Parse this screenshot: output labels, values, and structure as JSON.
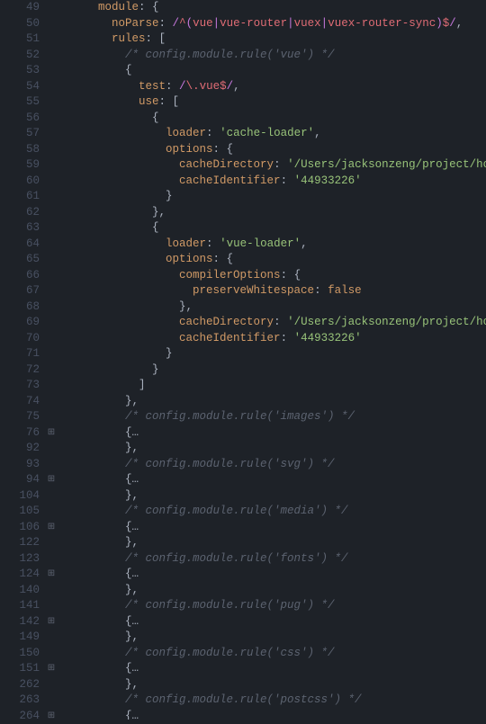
{
  "lines": [
    {
      "num": 49,
      "fold": "",
      "tokens": [
        {
          "cls": "p",
          "t": "      "
        },
        {
          "cls": "k",
          "t": "module"
        },
        {
          "cls": "p",
          "t": ": {"
        }
      ]
    },
    {
      "num": 50,
      "fold": "",
      "tokens": [
        {
          "cls": "p",
          "t": "        "
        },
        {
          "cls": "k",
          "t": "noParse"
        },
        {
          "cls": "p",
          "t": ": "
        },
        {
          "cls": "rk",
          "t": "/"
        },
        {
          "cls": "rx",
          "t": "^"
        },
        {
          "cls": "rk",
          "t": "("
        },
        {
          "cls": "rx",
          "t": "vue"
        },
        {
          "cls": "rk",
          "t": "|"
        },
        {
          "cls": "rx",
          "t": "vue-router"
        },
        {
          "cls": "rk",
          "t": "|"
        },
        {
          "cls": "rx",
          "t": "vuex"
        },
        {
          "cls": "rk",
          "t": "|"
        },
        {
          "cls": "rx",
          "t": "vuex-router-sync"
        },
        {
          "cls": "rk",
          "t": ")"
        },
        {
          "cls": "rx",
          "t": "$"
        },
        {
          "cls": "rk",
          "t": "/"
        },
        {
          "cls": "p",
          "t": ","
        }
      ]
    },
    {
      "num": 51,
      "fold": "",
      "tokens": [
        {
          "cls": "p",
          "t": "        "
        },
        {
          "cls": "k",
          "t": "rules"
        },
        {
          "cls": "p",
          "t": ": ["
        }
      ]
    },
    {
      "num": 52,
      "fold": "",
      "tokens": [
        {
          "cls": "p",
          "t": "          "
        },
        {
          "cls": "c",
          "t": "/* config.module.rule('vue') */"
        }
      ]
    },
    {
      "num": 53,
      "fold": "",
      "tokens": [
        {
          "cls": "p",
          "t": "          {"
        }
      ]
    },
    {
      "num": 54,
      "fold": "",
      "tokens": [
        {
          "cls": "p",
          "t": "            "
        },
        {
          "cls": "k",
          "t": "test"
        },
        {
          "cls": "p",
          "t": ": "
        },
        {
          "cls": "rk",
          "t": "/"
        },
        {
          "cls": "rx",
          "t": "\\."
        },
        {
          "cls": "rx",
          "t": "vue"
        },
        {
          "cls": "rx",
          "t": "$"
        },
        {
          "cls": "rk",
          "t": "/"
        },
        {
          "cls": "p",
          "t": ","
        }
      ]
    },
    {
      "num": 55,
      "fold": "",
      "tokens": [
        {
          "cls": "p",
          "t": "            "
        },
        {
          "cls": "k",
          "t": "use"
        },
        {
          "cls": "p",
          "t": ": ["
        }
      ]
    },
    {
      "num": 56,
      "fold": "",
      "tokens": [
        {
          "cls": "p",
          "t": "              {"
        }
      ]
    },
    {
      "num": 57,
      "fold": "",
      "tokens": [
        {
          "cls": "p",
          "t": "                "
        },
        {
          "cls": "k",
          "t": "loader"
        },
        {
          "cls": "p",
          "t": ": "
        },
        {
          "cls": "s",
          "t": "'cache-loader'"
        },
        {
          "cls": "p",
          "t": ","
        }
      ]
    },
    {
      "num": 58,
      "fold": "",
      "tokens": [
        {
          "cls": "p",
          "t": "                "
        },
        {
          "cls": "k",
          "t": "options"
        },
        {
          "cls": "p",
          "t": ": {"
        }
      ]
    },
    {
      "num": 59,
      "fold": "",
      "tokens": [
        {
          "cls": "p",
          "t": "                  "
        },
        {
          "cls": "k",
          "t": "cacheDirectory"
        },
        {
          "cls": "p",
          "t": ": "
        },
        {
          "cls": "s",
          "t": "'/Users/jacksonzeng/project/homepage/nod"
        }
      ]
    },
    {
      "num": 60,
      "fold": "",
      "tokens": [
        {
          "cls": "p",
          "t": "                  "
        },
        {
          "cls": "k",
          "t": "cacheIdentifier"
        },
        {
          "cls": "p",
          "t": ": "
        },
        {
          "cls": "s",
          "t": "'44933226'"
        }
      ]
    },
    {
      "num": 61,
      "fold": "",
      "tokens": [
        {
          "cls": "p",
          "t": "                }"
        }
      ]
    },
    {
      "num": 62,
      "fold": "",
      "tokens": [
        {
          "cls": "p",
          "t": "              },"
        }
      ]
    },
    {
      "num": 63,
      "fold": "",
      "tokens": [
        {
          "cls": "p",
          "t": "              {"
        }
      ]
    },
    {
      "num": 64,
      "fold": "",
      "tokens": [
        {
          "cls": "p",
          "t": "                "
        },
        {
          "cls": "k",
          "t": "loader"
        },
        {
          "cls": "p",
          "t": ": "
        },
        {
          "cls": "s",
          "t": "'vue-loader'"
        },
        {
          "cls": "p",
          "t": ","
        }
      ]
    },
    {
      "num": 65,
      "fold": "",
      "tokens": [
        {
          "cls": "p",
          "t": "                "
        },
        {
          "cls": "k",
          "t": "options"
        },
        {
          "cls": "p",
          "t": ": {"
        }
      ]
    },
    {
      "num": 66,
      "fold": "",
      "tokens": [
        {
          "cls": "p",
          "t": "                  "
        },
        {
          "cls": "k",
          "t": "compilerOptions"
        },
        {
          "cls": "p",
          "t": ": {"
        }
      ]
    },
    {
      "num": 67,
      "fold": "",
      "tokens": [
        {
          "cls": "p",
          "t": "                    "
        },
        {
          "cls": "k",
          "t": "preserveWhitespace"
        },
        {
          "cls": "p",
          "t": ": "
        },
        {
          "cls": "b",
          "t": "false"
        }
      ]
    },
    {
      "num": 68,
      "fold": "",
      "tokens": [
        {
          "cls": "p",
          "t": "                  },"
        }
      ]
    },
    {
      "num": 69,
      "fold": "",
      "tokens": [
        {
          "cls": "p",
          "t": "                  "
        },
        {
          "cls": "k",
          "t": "cacheDirectory"
        },
        {
          "cls": "p",
          "t": ": "
        },
        {
          "cls": "s",
          "t": "'/Users/jacksonzeng/project/homepage/nod"
        }
      ]
    },
    {
      "num": 70,
      "fold": "",
      "tokens": [
        {
          "cls": "p",
          "t": "                  "
        },
        {
          "cls": "k",
          "t": "cacheIdentifier"
        },
        {
          "cls": "p",
          "t": ": "
        },
        {
          "cls": "s",
          "t": "'44933226'"
        }
      ]
    },
    {
      "num": 71,
      "fold": "",
      "tokens": [
        {
          "cls": "p",
          "t": "                }"
        }
      ]
    },
    {
      "num": 72,
      "fold": "",
      "tokens": [
        {
          "cls": "p",
          "t": "              }"
        }
      ]
    },
    {
      "num": 73,
      "fold": "",
      "tokens": [
        {
          "cls": "p",
          "t": "            ]"
        }
      ]
    },
    {
      "num": 74,
      "fold": "",
      "tokens": [
        {
          "cls": "p",
          "t": "          },"
        }
      ]
    },
    {
      "num": 75,
      "fold": "",
      "tokens": [
        {
          "cls": "p",
          "t": "          "
        },
        {
          "cls": "c",
          "t": "/* config.module.rule('images') */"
        }
      ]
    },
    {
      "num": 76,
      "fold": "+",
      "tokens": [
        {
          "cls": "p",
          "t": "          {"
        },
        {
          "cls": "fold-dots",
          "t": "…"
        }
      ]
    },
    {
      "num": 92,
      "fold": "",
      "tokens": [
        {
          "cls": "p",
          "t": "          },"
        }
      ]
    },
    {
      "num": 93,
      "fold": "",
      "tokens": [
        {
          "cls": "p",
          "t": "          "
        },
        {
          "cls": "c",
          "t": "/* config.module.rule('svg') */"
        }
      ]
    },
    {
      "num": 94,
      "fold": "+",
      "tokens": [
        {
          "cls": "p",
          "t": "          {"
        },
        {
          "cls": "fold-dots",
          "t": "…"
        }
      ]
    },
    {
      "num": 104,
      "fold": "",
      "tokens": [
        {
          "cls": "p",
          "t": "          },"
        }
      ]
    },
    {
      "num": 105,
      "fold": "",
      "tokens": [
        {
          "cls": "p",
          "t": "          "
        },
        {
          "cls": "c",
          "t": "/* config.module.rule('media') */"
        }
      ]
    },
    {
      "num": 106,
      "fold": "+",
      "tokens": [
        {
          "cls": "p",
          "t": "          {"
        },
        {
          "cls": "fold-dots",
          "t": "…"
        }
      ]
    },
    {
      "num": 122,
      "fold": "",
      "tokens": [
        {
          "cls": "p",
          "t": "          },"
        }
      ]
    },
    {
      "num": 123,
      "fold": "",
      "tokens": [
        {
          "cls": "p",
          "t": "          "
        },
        {
          "cls": "c",
          "t": "/* config.module.rule('fonts') */"
        }
      ]
    },
    {
      "num": 124,
      "fold": "+",
      "tokens": [
        {
          "cls": "p",
          "t": "          {"
        },
        {
          "cls": "fold-dots",
          "t": "…"
        }
      ]
    },
    {
      "num": 140,
      "fold": "",
      "tokens": [
        {
          "cls": "p",
          "t": "          },"
        }
      ]
    },
    {
      "num": 141,
      "fold": "",
      "tokens": [
        {
          "cls": "p",
          "t": "          "
        },
        {
          "cls": "c",
          "t": "/* config.module.rule('pug') */"
        }
      ]
    },
    {
      "num": 142,
      "fold": "+",
      "tokens": [
        {
          "cls": "p",
          "t": "          {"
        },
        {
          "cls": "fold-dots",
          "t": "…"
        }
      ]
    },
    {
      "num": 149,
      "fold": "",
      "tokens": [
        {
          "cls": "p",
          "t": "          },"
        }
      ]
    },
    {
      "num": 150,
      "fold": "",
      "tokens": [
        {
          "cls": "p",
          "t": "          "
        },
        {
          "cls": "c",
          "t": "/* config.module.rule('css') */"
        }
      ]
    },
    {
      "num": 151,
      "fold": "+",
      "tokens": [
        {
          "cls": "p",
          "t": "          {"
        },
        {
          "cls": "fold-dots",
          "t": "…"
        }
      ]
    },
    {
      "num": 262,
      "fold": "",
      "tokens": [
        {
          "cls": "p",
          "t": "          },"
        }
      ]
    },
    {
      "num": 263,
      "fold": "",
      "tokens": [
        {
          "cls": "p",
          "t": "          "
        },
        {
          "cls": "c",
          "t": "/* config.module.rule('postcss') */"
        }
      ]
    },
    {
      "num": 264,
      "fold": "+",
      "tokens": [
        {
          "cls": "p",
          "t": "          {"
        },
        {
          "cls": "fold-dots",
          "t": "…"
        }
      ]
    }
  ]
}
